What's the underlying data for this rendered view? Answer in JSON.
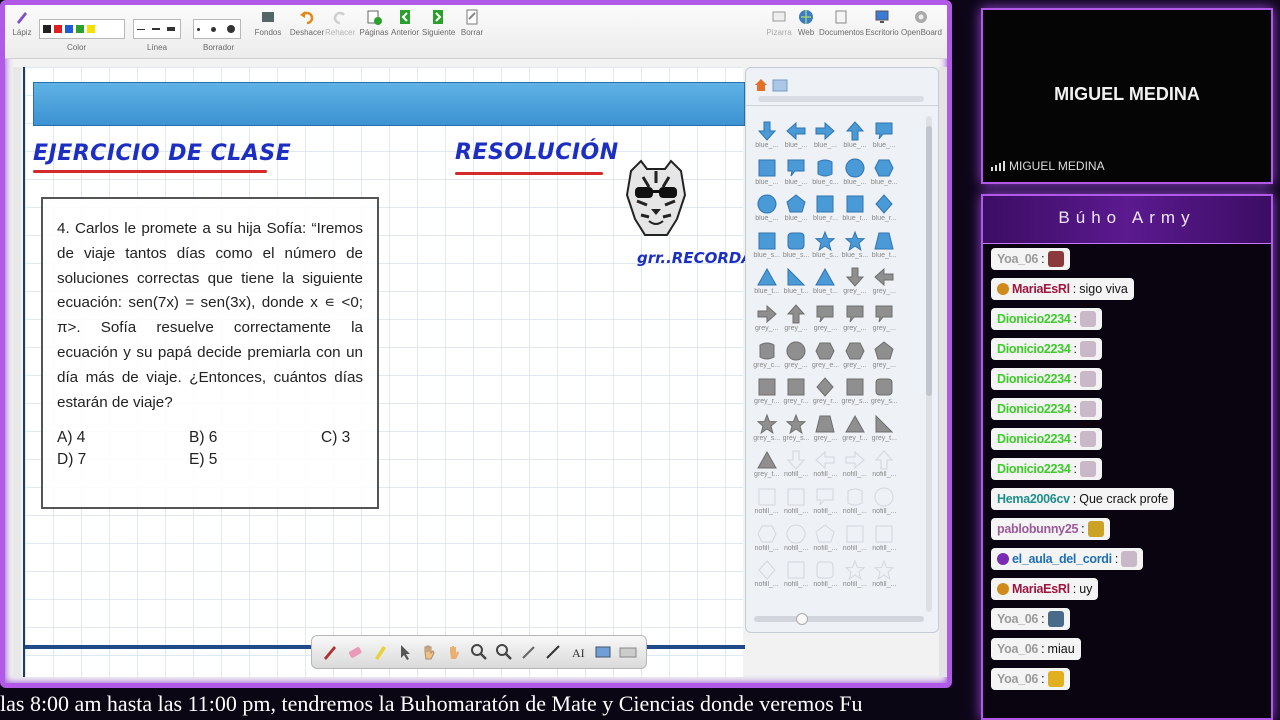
{
  "toolbar": {
    "lapiz": "Lápiz",
    "color": "Color",
    "linea": "Línea",
    "borrador": "Borrador",
    "fondos": "Fondos",
    "deshacer": "Deshacer",
    "rehacer": "Rehacer",
    "paginas": "Páginas",
    "anterior": "Anterior",
    "siguiente": "Siguiente",
    "borrar": "Borrar",
    "pizarra": "Pizarra",
    "web": "Web",
    "documentos": "Documentos",
    "escritorio": "Escritorio",
    "openboard": "OpenBoard",
    "colors": [
      "#222222",
      "#e02020",
      "#1f5bd6",
      "#2ca02c",
      "#f5e000"
    ]
  },
  "board": {
    "title_left": "EJERCICIO DE CLASE",
    "title_right": "RESOLUCIÓN",
    "tiger_caption": "grr..RECORDAR",
    "problem": "4. Carlos le promete a su hija Sofía: “Iremos de viaje tantos días como el número de soluciones correctas que tiene la siguiente ecuación: sen(7x) = sen(3x), donde x ∊ <0; π>. Sofía resuelve correctamente la ecuación y su papá decide premiarla con un día más de viaje. ¿Entonces, cuántos días estarán de viaje?",
    "options": [
      "A) 4",
      "B) 6",
      "C) 3",
      "D) 7",
      "E) 5"
    ]
  },
  "gallery": {
    "labels": [
      "blue_...",
      "blue_...",
      "blue_...",
      "blue_...",
      "blue_...",
      "blue_...",
      "blue_...",
      "blue_c...",
      "blue_...",
      "blue_e...",
      "blue_...",
      "blue_...",
      "blue_r...",
      "blue_r...",
      "blue_r...",
      "blue_s...",
      "blue_s...",
      "blue_s...",
      "blue_s...",
      "blue_t...",
      "blue_t...",
      "blue_t...",
      "blue_t...",
      "grey_...",
      "grey_...",
      "grey_...",
      "grey_...",
      "grey_...",
      "grey_...",
      "grey_...",
      "grey_c...",
      "grey_...",
      "grey_e...",
      "grey_...",
      "grey_...",
      "grey_r...",
      "grey_r...",
      "grey_r...",
      "grey_s...",
      "grey_s...",
      "grey_s...",
      "grey_s...",
      "grey_...",
      "grey_t...",
      "grey_t...",
      "grey_t...",
      "nofill_...",
      "nofill_...",
      "nofill_...",
      "nofill_...",
      "nofill_...",
      "nofill_...",
      "nofill_...",
      "nofill_...",
      "nofill_...",
      "nofill_...",
      "nofill_...",
      "nofill_...",
      "nofill_...",
      "nofill_...",
      "nofill_...",
      "nofill_...",
      "nofill_...",
      "nofill_...",
      "nofill_..."
    ]
  },
  "ticker": "las 8:00 am hasta las 11:00 pm, tendremos la Buhomaratón de Mate y Ciencias donde veremos Fu",
  "webcam": {
    "name": "MIGUEL MEDINA",
    "label": "MIGUEL MEDINA"
  },
  "chat": {
    "title": "Búho Army",
    "messages": [
      {
        "user": "Yoa_06",
        "color": "#9a9a9a",
        "text": "",
        "emote": "#8a3a3a",
        "badge": ""
      },
      {
        "user": "MariaEsRl",
        "color": "#a0153e",
        "text": "sigo viva",
        "emote": "",
        "badge": "#d08a1a"
      },
      {
        "user": "Dionicio2234",
        "color": "#3ecb2b",
        "text": "",
        "emote": "#c8b8c8",
        "badge": ""
      },
      {
        "user": "Dionicio2234",
        "color": "#3ecb2b",
        "text": "",
        "emote": "#c8b8c8",
        "badge": ""
      },
      {
        "user": "Dionicio2234",
        "color": "#3ecb2b",
        "text": "",
        "emote": "#c8b8c8",
        "badge": ""
      },
      {
        "user": "Dionicio2234",
        "color": "#3ecb2b",
        "text": "",
        "emote": "#c8b8c8",
        "badge": ""
      },
      {
        "user": "Dionicio2234",
        "color": "#3ecb2b",
        "text": "",
        "emote": "#c8b8c8",
        "badge": ""
      },
      {
        "user": "Dionicio2234",
        "color": "#3ecb2b",
        "text": "",
        "emote": "#c8b8c8",
        "badge": ""
      },
      {
        "user": "Hema2006cv",
        "color": "#1e8f8a",
        "text": "Que crack profe",
        "emote": "",
        "badge": ""
      },
      {
        "user": "pablobunny25",
        "color": "#9a5a9a",
        "text": "",
        "emote": "#c9a226",
        "badge": ""
      },
      {
        "user": "el_aula_del_cordi",
        "color": "#1f6fb5",
        "text": "",
        "emote": "#c8b8c8",
        "badge": "#7a2bb5"
      },
      {
        "user": "MariaEsRl",
        "color": "#a0153e",
        "text": "uy",
        "emote": "",
        "badge": "#d08a1a"
      },
      {
        "user": "Yoa_06",
        "color": "#9a9a9a",
        "text": "",
        "emote": "#4a6a8a",
        "badge": ""
      },
      {
        "user": "Yoa_06",
        "color": "#9a9a9a",
        "text": "miau",
        "emote": "",
        "badge": ""
      },
      {
        "user": "Yoa_06",
        "color": "#9a9a9a",
        "text": "",
        "emote": "#e0b020",
        "badge": ""
      }
    ]
  }
}
